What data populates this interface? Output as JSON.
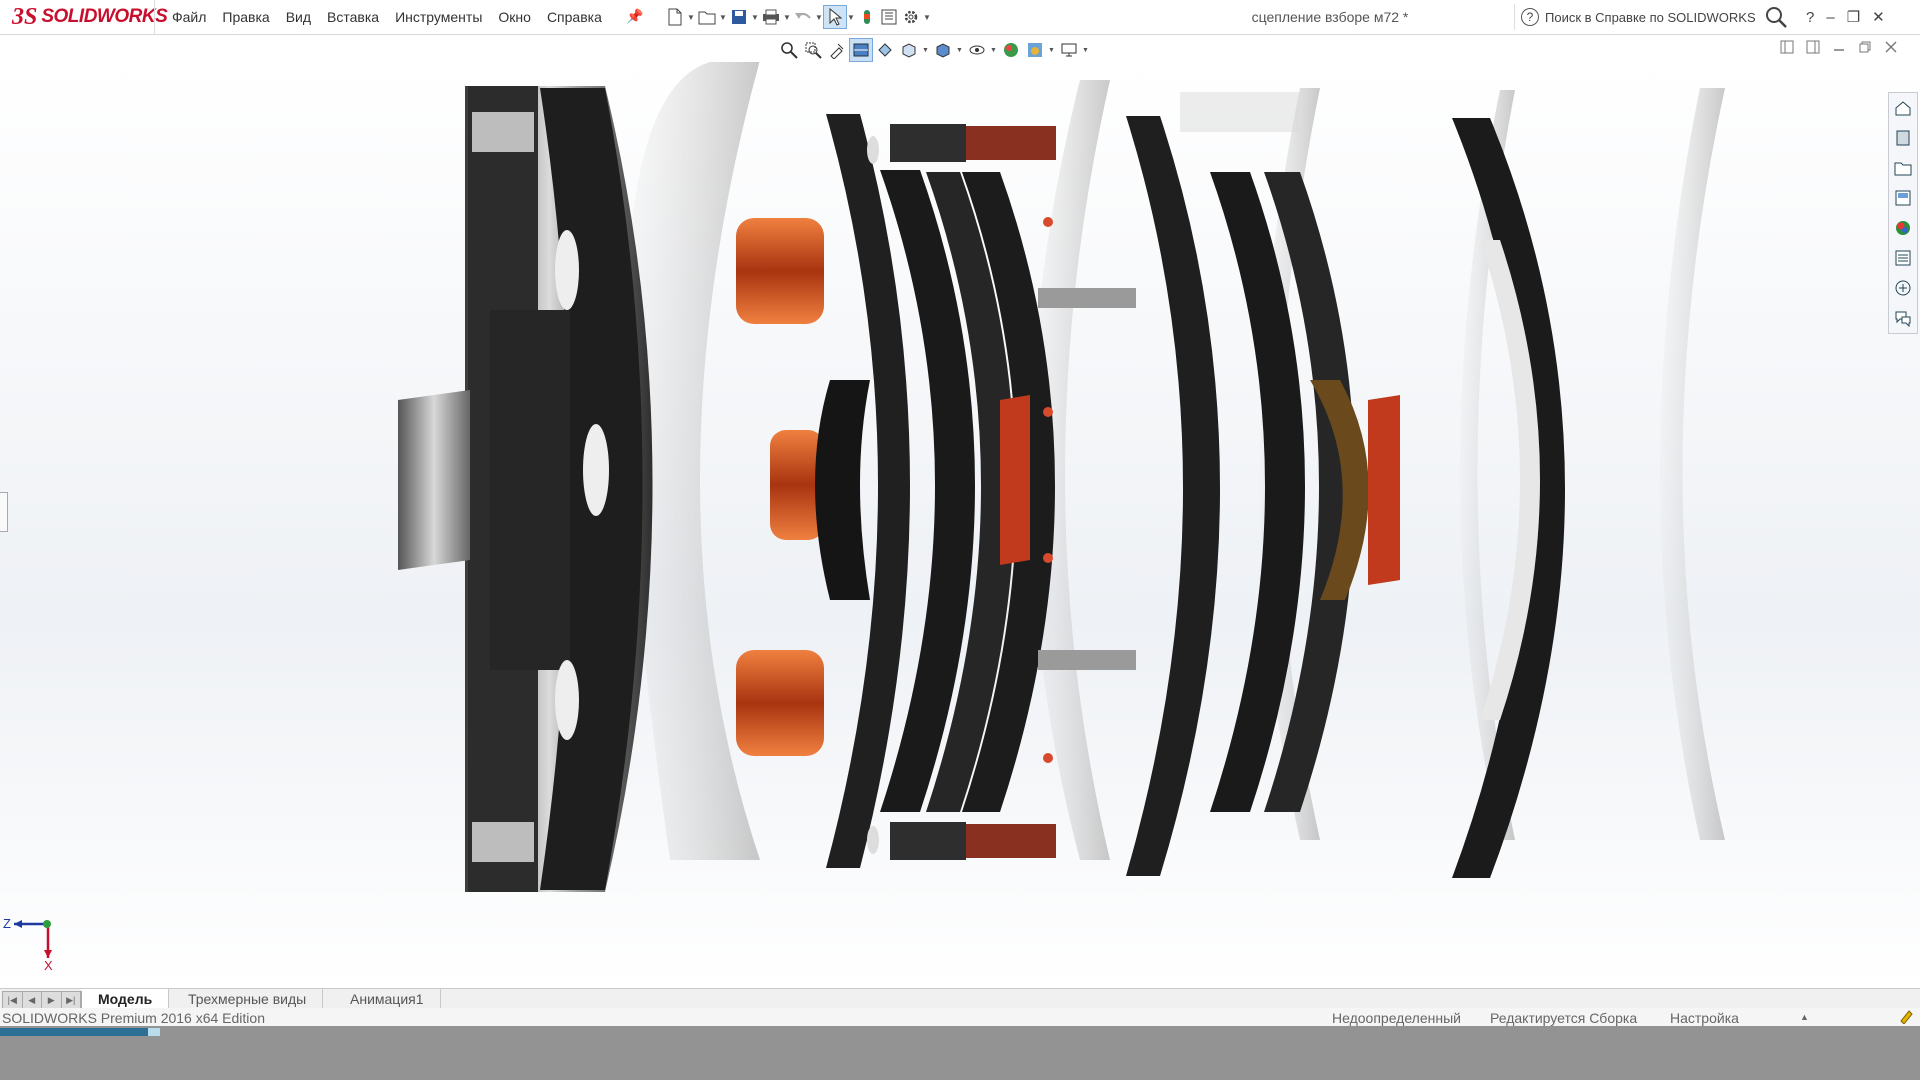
{
  "app": {
    "logo_mark": "3S",
    "logo_text": "SOLIDWORKS"
  },
  "menu": [
    "Файл",
    "Правка",
    "Вид",
    "Вставка",
    "Инструменты",
    "Окно",
    "Справка"
  ],
  "document": {
    "title": "сцепление взборе м72 *"
  },
  "search": {
    "placeholder": "Поиск в Справке по SOLIDWORKS"
  },
  "window_controls": {
    "help": "?",
    "minimize": "–",
    "restore": "❐",
    "close": "✕"
  },
  "tabs": [
    {
      "label": "Модель",
      "active": true
    },
    {
      "label": "Трехмерные виды",
      "active": false
    },
    {
      "label": "Анимация1",
      "active": false
    }
  ],
  "status": {
    "edition": "SOLIDWORKS Premium 2016 x64 Edition",
    "definition": "Недоопределенный",
    "mode": "Редактируется Сборка",
    "settings": "Настройка"
  },
  "triad": {
    "z": "Z",
    "x": "X"
  },
  "colors": {
    "accent": "#c8102e",
    "spring": "#c0441c",
    "part": "#2a2a2a"
  }
}
